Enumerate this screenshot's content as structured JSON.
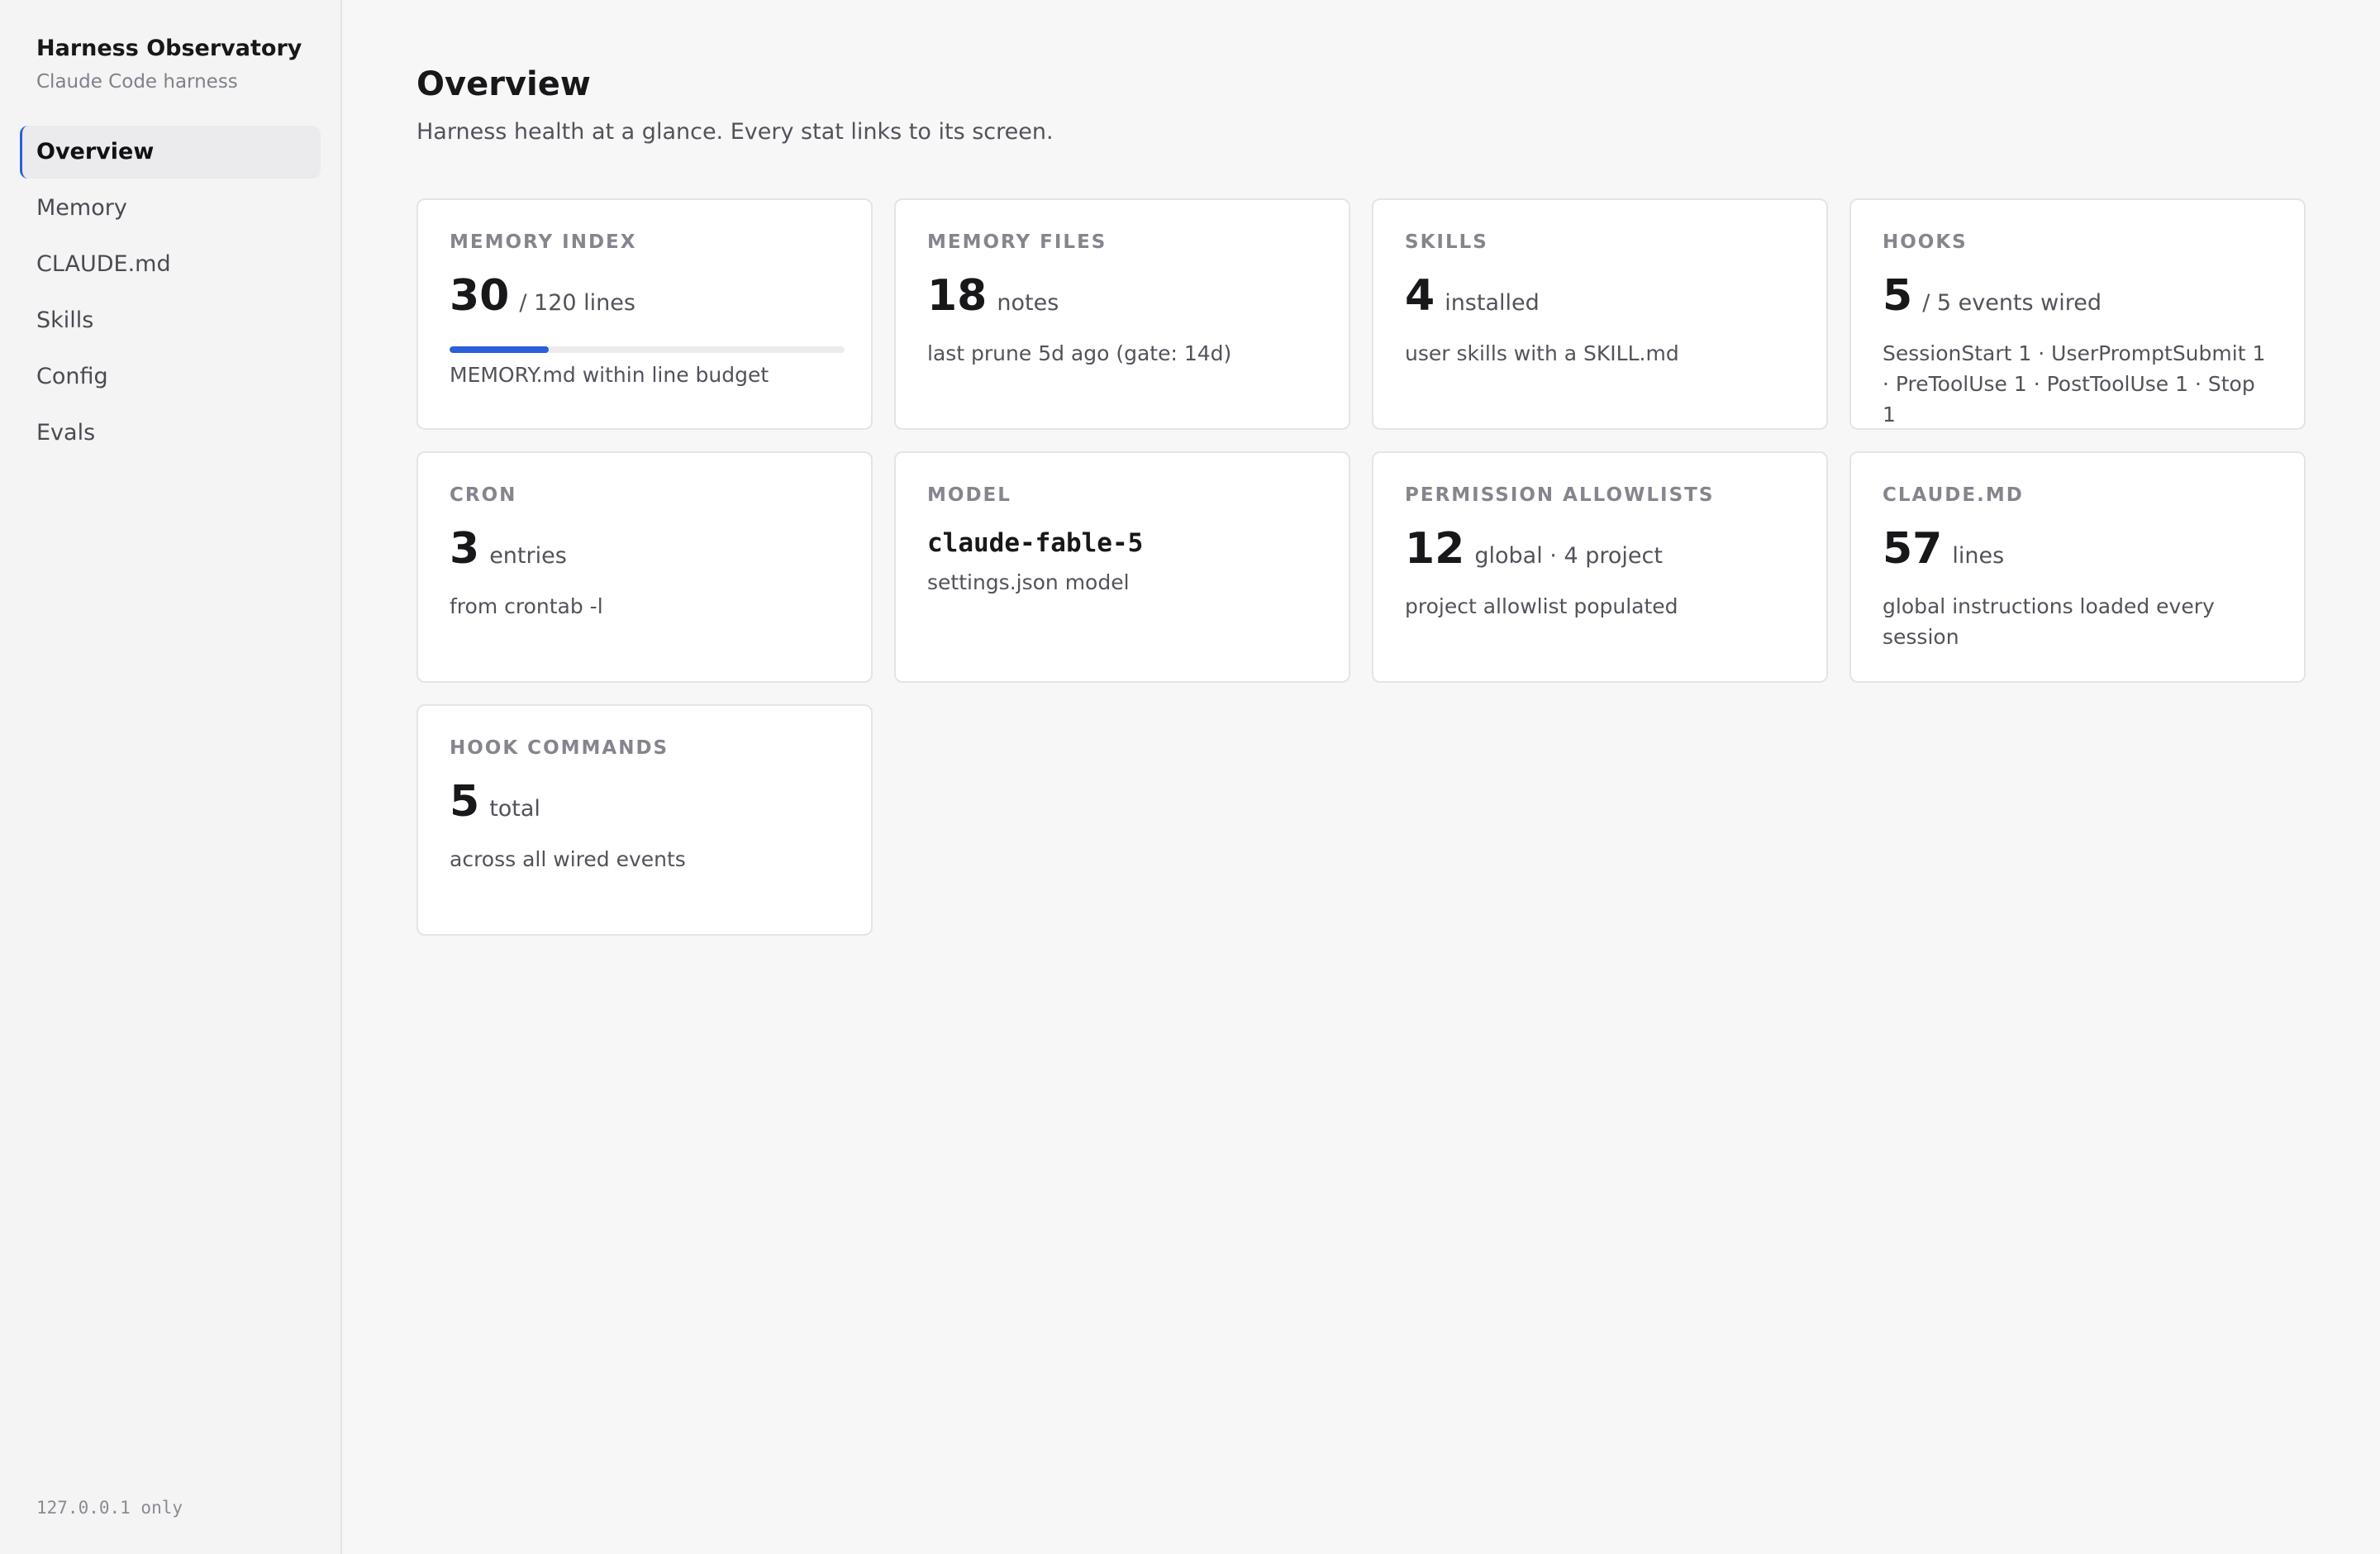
{
  "sidebar": {
    "title": "Harness Observatory",
    "subtitle": "Claude Code harness",
    "items": [
      {
        "label": "Overview",
        "active": true
      },
      {
        "label": "Memory"
      },
      {
        "label": "CLAUDE.md"
      },
      {
        "label": "Skills"
      },
      {
        "label": "Config"
      },
      {
        "label": "Evals"
      }
    ],
    "footer": "127.0.0.1 only"
  },
  "main": {
    "title": "Overview",
    "subtitle": "Harness health at a glance. Every stat links to its screen."
  },
  "cards": {
    "memory_index": {
      "label": "MEMORY INDEX",
      "value": "30",
      "unit": "/ 120 lines",
      "desc": "MEMORY.md within line budget",
      "progress_fraction": 0.25
    },
    "memory_files": {
      "label": "MEMORY FILES",
      "value": "18",
      "unit": "notes",
      "desc": "last prune 5d ago (gate: 14d)"
    },
    "skills": {
      "label": "SKILLS",
      "value": "4",
      "unit": "installed",
      "desc": "user skills with a SKILL.md"
    },
    "hooks": {
      "label": "HOOKS",
      "value": "5",
      "unit": "/ 5 events wired",
      "desc": "SessionStart 1 · UserPromptSubmit 1 · PreToolUse 1 · PostToolUse 1 · Stop 1"
    },
    "cron": {
      "label": "CRON",
      "value": "3",
      "unit": "entries",
      "desc": "from crontab -l"
    },
    "model": {
      "label": "MODEL",
      "value": "claude-fable-5",
      "desc": "settings.json model"
    },
    "permission_allowlists": {
      "label": "PERMISSION ALLOWLISTS",
      "value": "12",
      "unit": "global · 4 project",
      "desc": "project allowlist populated"
    },
    "claude_md": {
      "label": "CLAUDE.MD",
      "value": "57",
      "unit": "lines",
      "desc": "global instructions loaded every session"
    },
    "hook_commands": {
      "label": "HOOK COMMANDS",
      "value": "5",
      "unit": "total",
      "desc": "across all wired events"
    }
  },
  "colors": {
    "accent": "#2b5fd9",
    "background": "#f7f7f7",
    "card": "#ffffff"
  }
}
